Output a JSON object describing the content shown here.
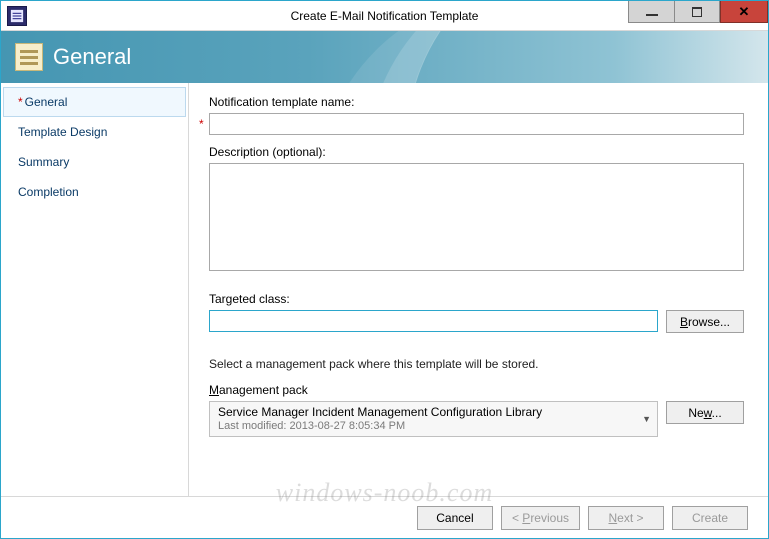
{
  "window": {
    "title": "Create E-Mail Notification Template"
  },
  "banner": {
    "heading": "General"
  },
  "sidebar": {
    "items": [
      {
        "label": "General",
        "required": true,
        "active": true
      },
      {
        "label": "Template Design",
        "required": false,
        "active": false
      },
      {
        "label": "Summary",
        "required": false,
        "active": false
      },
      {
        "label": "Completion",
        "required": false,
        "active": false
      }
    ]
  },
  "form": {
    "name_label": "Notification template name:",
    "name_value": "",
    "desc_label": "Description (optional):",
    "desc_value": "",
    "target_label": "Targeted class:",
    "target_value": "",
    "browse_label": "Browse...",
    "help_text": "Select a management pack where this template will be stored.",
    "mp_label": "Management pack",
    "mp_selected": "Service Manager Incident Management Configuration Library",
    "mp_modified_prefix": "Last modified:  ",
    "mp_modified_value": "2013-08-27 8:05:34 PM",
    "new_label": "New..."
  },
  "footer": {
    "cancel": "Cancel",
    "previous_pre": "< ",
    "previous_u": "P",
    "previous_post": "revious",
    "next_u": "N",
    "next_post": "ext >",
    "create": "Create"
  },
  "watermark": "windows-noob.com"
}
